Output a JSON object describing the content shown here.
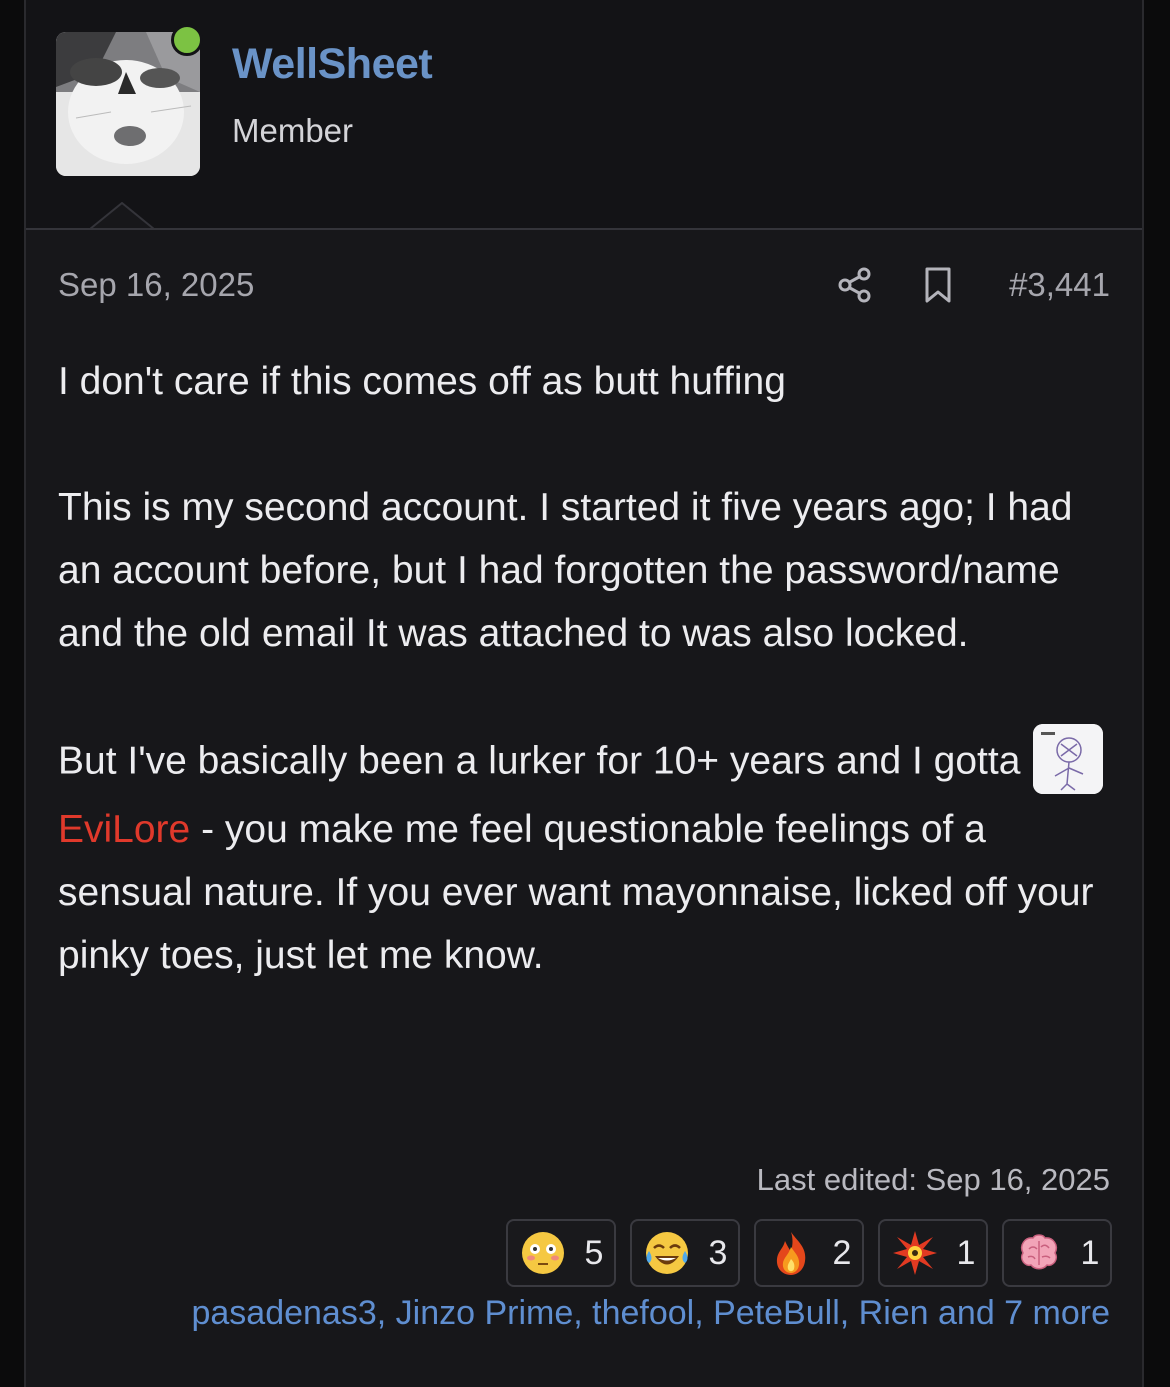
{
  "post": {
    "author": {
      "name": "WellSheet",
      "title": "Member",
      "online": true
    },
    "date": "Sep 16, 2025",
    "number": "#3,441",
    "paragraphs": {
      "p1": "I don't care if this comes off as butt huffing",
      "p2": "This is my second account. I started it five years ago; I had an account before, but I had forgotten the password/name and the old email It was attached to was also locked.",
      "p3_before": "But I've basically been a lurker for 10+ years and I gotta",
      "p3_mention": "EviLore",
      "p3_after": " - you make me feel questionable feelings of a sensual nature. If you ever want mayonnaise, licked off your pinky toes, just let me know."
    },
    "last_edited": "Last edited: Sep 16, 2025",
    "reactions": [
      {
        "icon": "flushed-face-icon",
        "count": "5"
      },
      {
        "icon": "tears-of-joy-icon",
        "count": "3"
      },
      {
        "icon": "fire-icon",
        "count": "2"
      },
      {
        "icon": "explosion-star-icon",
        "count": "1"
      },
      {
        "icon": "brain-icon",
        "count": "1"
      }
    ],
    "reactors": "pasadenas3, Jinzo Prime, thefool, PeteBull, Rien and 7 more"
  },
  "colors": {
    "username": "#6a93c7",
    "mention": "#e0392b",
    "reactors": "#5f8ed0",
    "online_dot": "#7cc243"
  }
}
